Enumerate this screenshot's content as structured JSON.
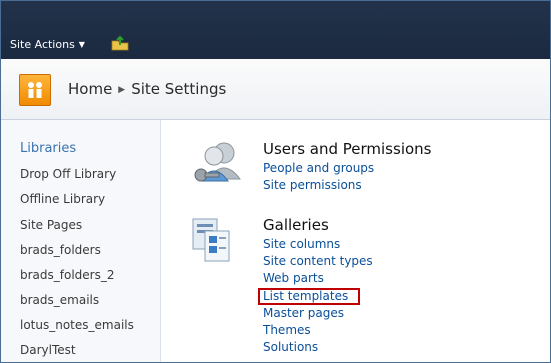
{
  "topbar": {
    "site_actions": "Site Actions"
  },
  "title": {
    "home": "Home",
    "current": "Site Settings"
  },
  "leftnav": {
    "heading": "Libraries",
    "items": [
      "Drop Off Library",
      "Offline Library",
      "Site Pages",
      "brads_folders",
      "brads_folders_2",
      "brads_emails",
      "lotus_notes_emails",
      "DarylTest"
    ]
  },
  "sections": {
    "users": {
      "title": "Users and Permissions",
      "links": [
        "People and groups",
        "Site permissions"
      ]
    },
    "galleries": {
      "title": "Galleries",
      "links": [
        "Site columns",
        "Site content types",
        "Web parts",
        "List templates",
        "Master pages",
        "Themes",
        "Solutions"
      ]
    }
  },
  "colors": {
    "highlight": "#c00000",
    "link": "#0a4f99",
    "topbar": "#1b2a40"
  }
}
